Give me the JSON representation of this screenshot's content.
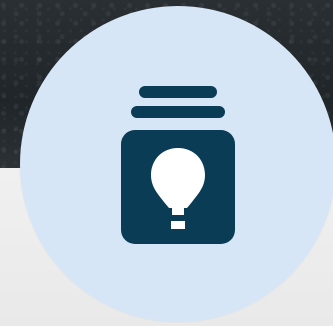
{
  "app": {
    "icon_name": "lightbulb-jar-icon",
    "colors": {
      "banner_dark": "#1f2529",
      "background_light": "#ececec",
      "circle_fill": "#d6e6f7",
      "icon_fill": "#0b3c55",
      "bulb_fill": "#ffffff"
    }
  }
}
